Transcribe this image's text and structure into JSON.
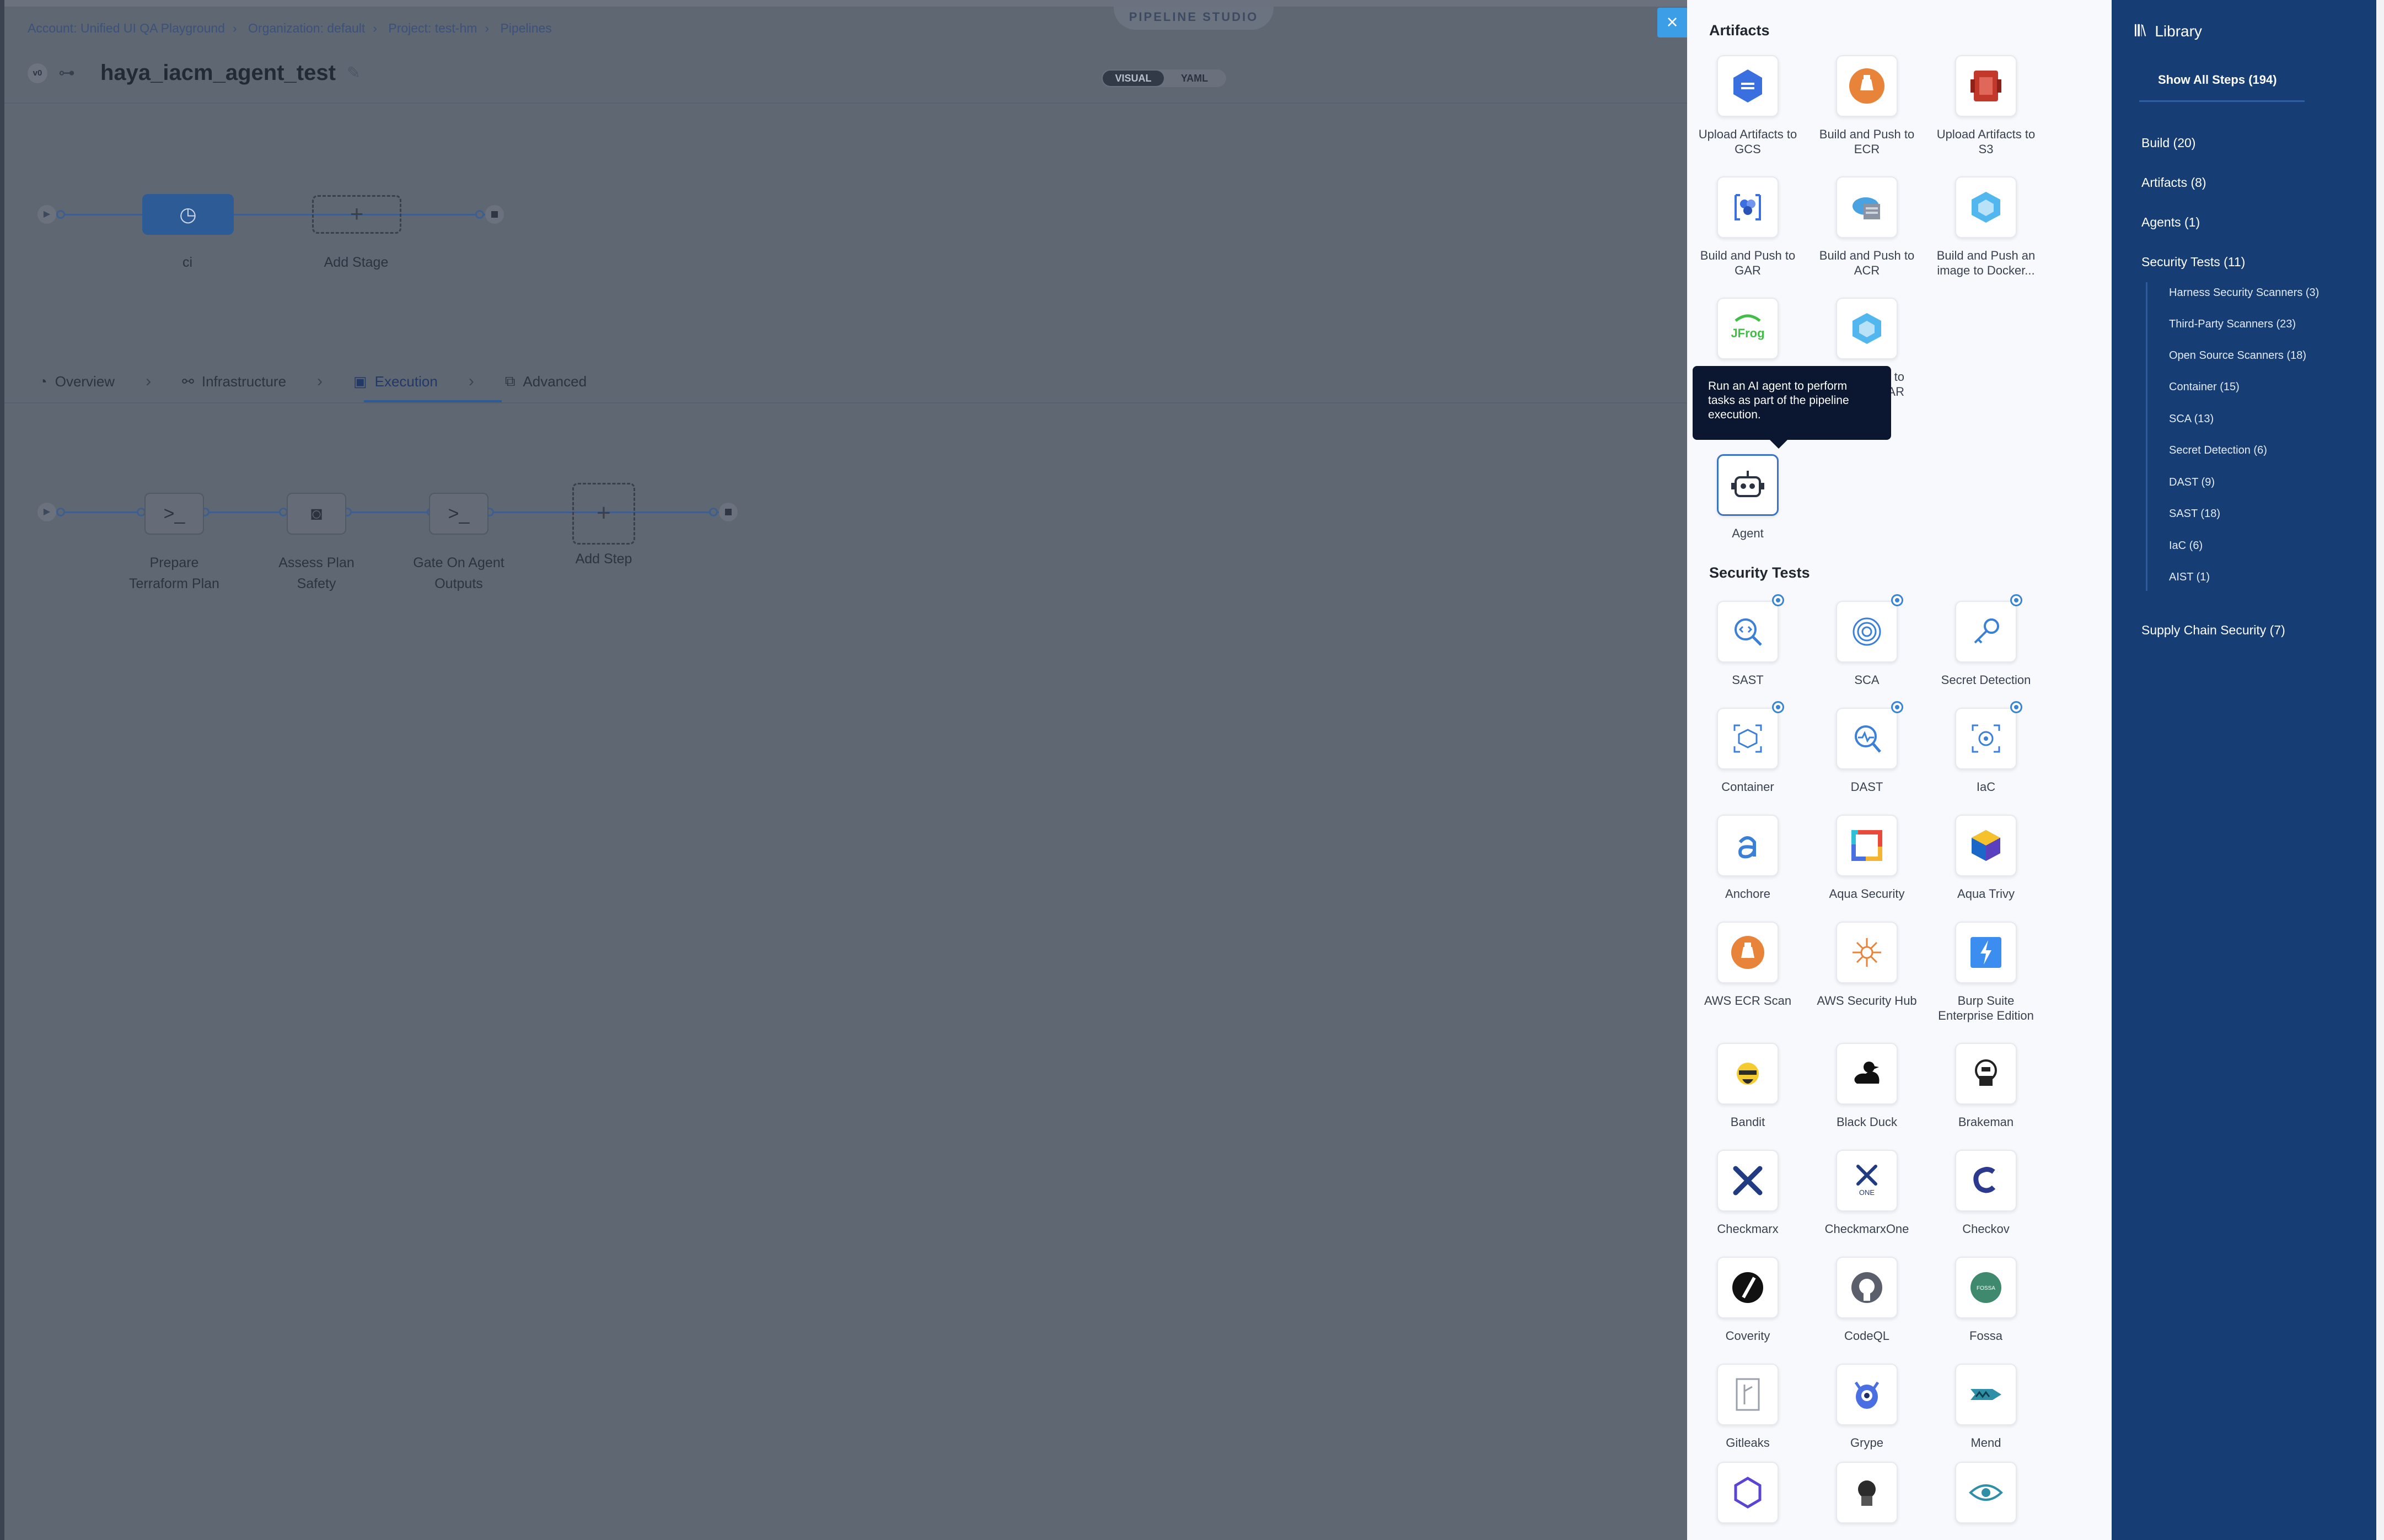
{
  "breadcrumb": [
    "Account: Unified UI QA Playground",
    "Organization: default",
    "Project: test-hm",
    "Pipelines"
  ],
  "studio_badge": "PIPELINE STUDIO",
  "pipeline": {
    "version": "v0",
    "title": "haya_iacm_agent_test"
  },
  "view_toggle": {
    "visual": "VISUAL",
    "yaml": "YAML"
  },
  "stages": {
    "ci": "ci",
    "add_stage": "Add Stage"
  },
  "tabs": [
    "Overview",
    "Infrastructure",
    "Execution",
    "Advanced"
  ],
  "steps": [
    "Prepare\nTerraform Plan",
    "Assess Plan\nSafety",
    "Gate On Agent\nOutputs"
  ],
  "add_step": "Add Step",
  "palette": {
    "artifacts_title": "Artifacts",
    "artifacts": [
      "Upload Artifacts to\nGCS",
      "Build and Push to\nECR",
      "Upload Artifacts to\nS3",
      "Build and Push to\nGAR",
      "Build and Push to\nACR",
      "Build and Push an\nimage to Docker...",
      "",
      "Artifacts to\nHAR"
    ],
    "tooltip": "Run an AI agent to perform tasks as part of the pipeline execution.",
    "agent": "Agent",
    "security_title": "Security Tests",
    "security": [
      "SAST",
      "SCA",
      "Secret Detection",
      "Container",
      "DAST",
      "IaC",
      "Anchore",
      "Aqua Security",
      "Aqua Trivy",
      "AWS ECR Scan",
      "AWS Security Hub",
      "Burp Suite\nEnterprise Edition",
      "Bandit",
      "Black Duck",
      "Brakeman",
      "Checkmarx",
      "CheckmarxOne",
      "Checkov",
      "Coverity",
      "CodeQL",
      "Fossa",
      "Gitleaks",
      "Grype",
      "Mend"
    ],
    "tile_glyphs": {
      "fossa": "FOSSA",
      "one": "ONE",
      "jfrog": "JFrog"
    }
  },
  "library": {
    "title": "Library",
    "show_all": "Show All Steps (194)",
    "items": [
      "Build (20)",
      "Artifacts (8)",
      "Agents (1)",
      "Security Tests (11)",
      "Supply Chain Security (7)"
    ],
    "security_subitems": [
      "Harness Security Scanners (3)",
      "Third-Party Scanners (23)",
      "Open Source Scanners (18)",
      "Container (15)",
      "SCA (13)",
      "Secret Detection (6)",
      "DAST (9)",
      "SAST (18)",
      "IaC (6)",
      "AIST (1)"
    ]
  },
  "colors": {
    "accent": "#3a84d8",
    "library_bg": "#163e75",
    "overlay": "#5f6773",
    "tooltip_bg": "#0b1730"
  }
}
